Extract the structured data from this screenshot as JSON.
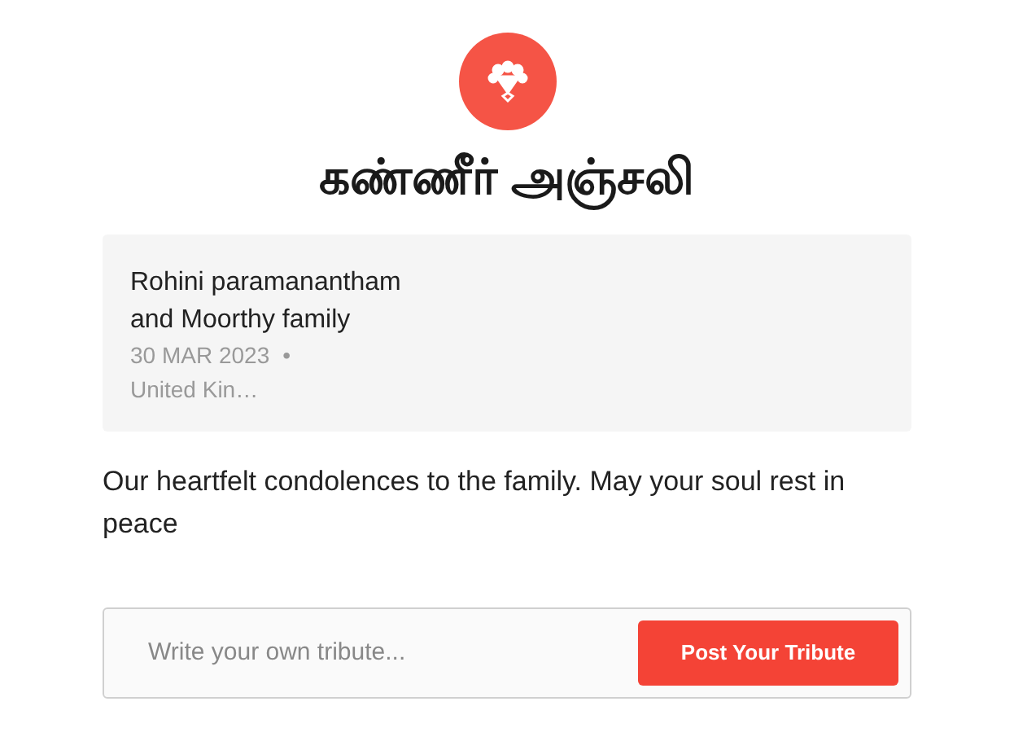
{
  "title": "கண்ணீர் அஞ்சலி",
  "card": {
    "author_line_1": "Rohini paramanantham",
    "author_line_2": "and Moorthy family",
    "date": "30 MAR 2023",
    "separator": "•",
    "location": "United Kin…"
  },
  "message": "Our heartfelt condolences to the family. May your soul rest in peace",
  "tribute_field": {
    "placeholder": "Write your own tribute..."
  },
  "post_button": "Post Your Tribute"
}
